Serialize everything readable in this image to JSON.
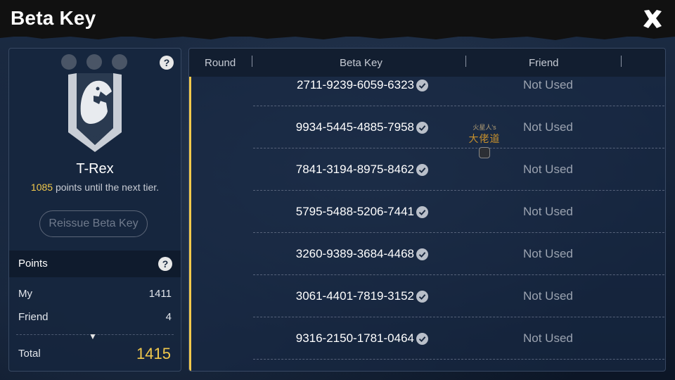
{
  "header": {
    "title": "Beta Key"
  },
  "tier": {
    "name": "T-Rex",
    "points_needed": "1085",
    "points_suffix": " points until the next tier.",
    "reissue_label": "Reissue Beta Key"
  },
  "points": {
    "title": "Points",
    "rows": [
      {
        "label": "My",
        "value": "1411"
      },
      {
        "label": "Friend",
        "value": "4"
      }
    ],
    "total_label": "Total",
    "total_value": "1415"
  },
  "table": {
    "columns": [
      "Round",
      "Beta Key",
      "Friend"
    ],
    "rows": [
      {
        "key": "2711-9239-6059-6323",
        "friend": "Not Used"
      },
      {
        "key": "9934-5445-4885-7958",
        "friend": "Not Used"
      },
      {
        "key": "7841-3194-8975-8462",
        "friend": "Not Used"
      },
      {
        "key": "5795-5488-5206-7441",
        "friend": "Not Used"
      },
      {
        "key": "3260-9389-3684-4468",
        "friend": "Not Used"
      },
      {
        "key": "3061-4401-7819-3152",
        "friend": "Not Used"
      },
      {
        "key": "9316-2150-1781-0464",
        "friend": "Not Used"
      }
    ]
  },
  "overlay": {
    "small": "火星人's",
    "big": "大佬道"
  },
  "icons": {
    "close": "close-icon",
    "help": "question-icon",
    "check": "check-circle-icon",
    "badge": "trex-badge-icon",
    "chevron": "chevron-down-icon"
  },
  "colors": {
    "accent": "#f2c94c",
    "muted": "#9ba3b0",
    "panel": "#16263e"
  }
}
